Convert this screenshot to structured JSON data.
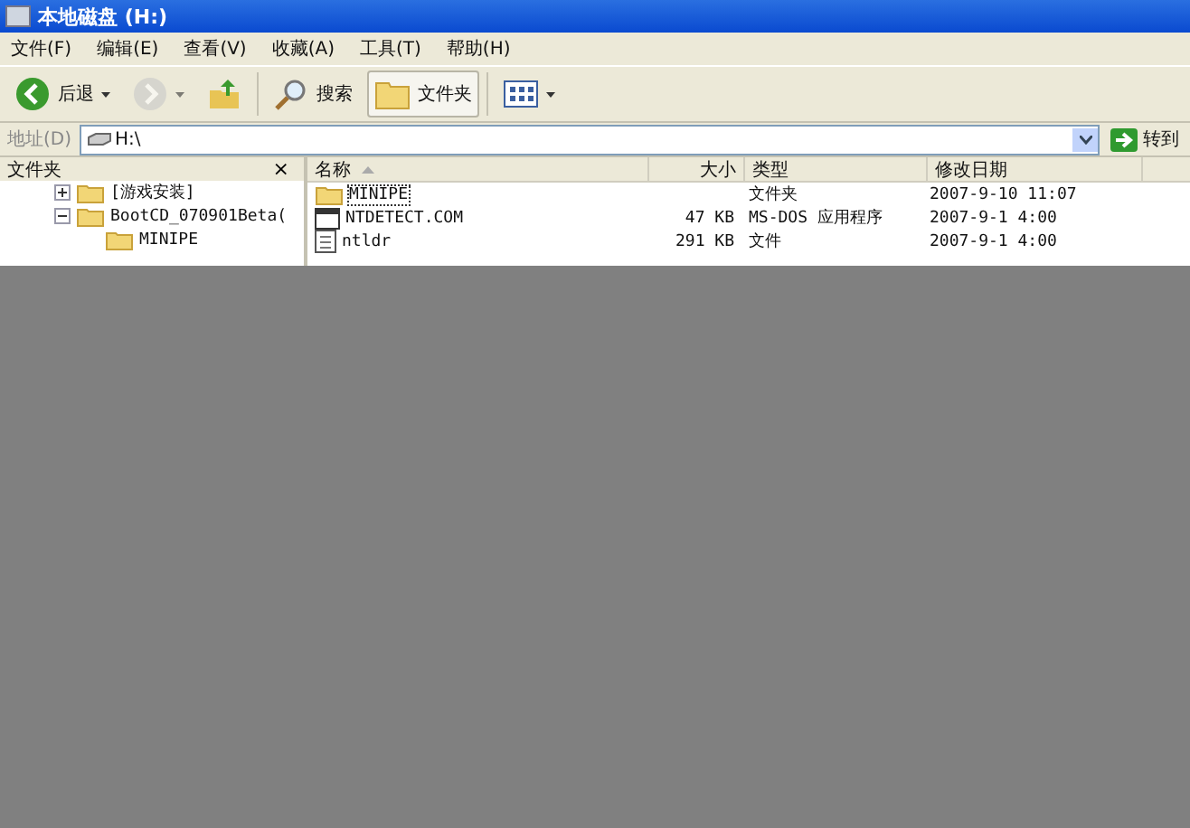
{
  "window": {
    "title": "本地磁盘 (H:)"
  },
  "menu": [
    "文件(F)",
    "编辑(E)",
    "查看(V)",
    "收藏(A)",
    "工具(T)",
    "帮助(H)"
  ],
  "toolbar": [
    {
      "kind": "back",
      "label": "后退",
      "disabled": false
    },
    {
      "kind": "forward",
      "disabled": true
    },
    {
      "kind": "up",
      "disabled": false
    },
    {
      "kind": "search",
      "label": "搜索",
      "disabled": false
    },
    {
      "kind": "folders",
      "label": "文件夹",
      "disabled": false,
      "selected": true
    },
    {
      "kind": "views",
      "disabled": false
    }
  ],
  "address": {
    "label": "地址(D)",
    "value": "H:\\",
    "go": "转到"
  },
  "folders_pane": {
    "title": "文件夹",
    "close": "×",
    "tree": [
      {
        "label": "[游戏安装]",
        "expanded": false
      },
      {
        "label": "BootCD_070901Beta(",
        "expanded": true,
        "children": [
          {
            "label": "MINIPE"
          }
        ]
      }
    ]
  },
  "table": {
    "columns": [
      {
        "label": "名称",
        "sorted": true
      },
      {
        "label": "大小",
        "sorted": false
      },
      {
        "label": "类型",
        "sorted": false
      },
      {
        "label": "修改日期",
        "sorted": false
      }
    ],
    "rows": [
      {
        "kind": "folder",
        "name": "MINIPE",
        "size": "",
        "type": "文件夹",
        "date": "2007-9-10 11:07",
        "selected": true
      },
      {
        "kind": "exe",
        "name": "NTDETECT.COM",
        "size": "47 KB",
        "type": "MS-DOS 应用程序",
        "date": "2007-9-1 4:00",
        "selected": false
      },
      {
        "kind": "file",
        "name": "ntldr",
        "size": "291 KB",
        "type": "文件",
        "date": "2007-9-1 4:00",
        "selected": false
      }
    ]
  }
}
